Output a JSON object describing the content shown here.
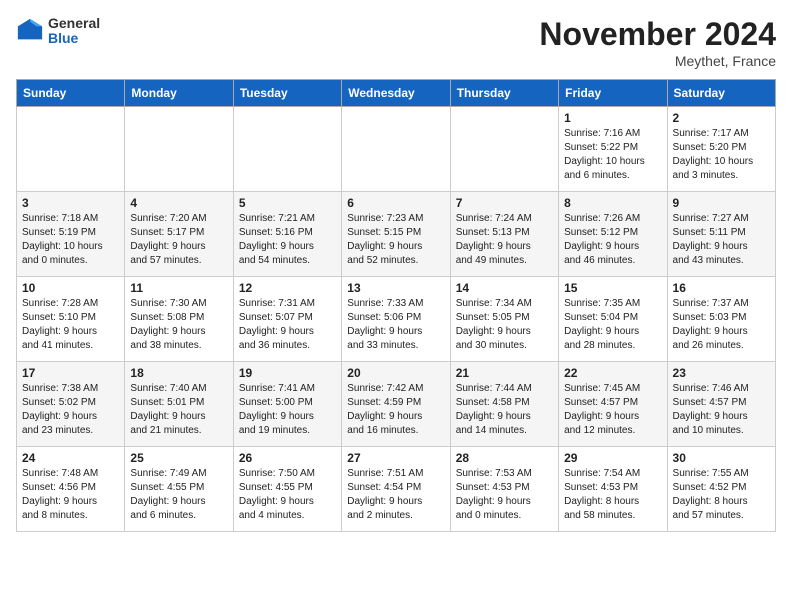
{
  "header": {
    "logo_general": "General",
    "logo_blue": "Blue",
    "month_title": "November 2024",
    "location": "Meythet, France"
  },
  "calendar": {
    "days_of_week": [
      "Sunday",
      "Monday",
      "Tuesday",
      "Wednesday",
      "Thursday",
      "Friday",
      "Saturday"
    ],
    "weeks": [
      [
        {
          "day": "",
          "info": ""
        },
        {
          "day": "",
          "info": ""
        },
        {
          "day": "",
          "info": ""
        },
        {
          "day": "",
          "info": ""
        },
        {
          "day": "",
          "info": ""
        },
        {
          "day": "1",
          "info": "Sunrise: 7:16 AM\nSunset: 5:22 PM\nDaylight: 10 hours\nand 6 minutes."
        },
        {
          "day": "2",
          "info": "Sunrise: 7:17 AM\nSunset: 5:20 PM\nDaylight: 10 hours\nand 3 minutes."
        }
      ],
      [
        {
          "day": "3",
          "info": "Sunrise: 7:18 AM\nSunset: 5:19 PM\nDaylight: 10 hours\nand 0 minutes."
        },
        {
          "day": "4",
          "info": "Sunrise: 7:20 AM\nSunset: 5:17 PM\nDaylight: 9 hours\nand 57 minutes."
        },
        {
          "day": "5",
          "info": "Sunrise: 7:21 AM\nSunset: 5:16 PM\nDaylight: 9 hours\nand 54 minutes."
        },
        {
          "day": "6",
          "info": "Sunrise: 7:23 AM\nSunset: 5:15 PM\nDaylight: 9 hours\nand 52 minutes."
        },
        {
          "day": "7",
          "info": "Sunrise: 7:24 AM\nSunset: 5:13 PM\nDaylight: 9 hours\nand 49 minutes."
        },
        {
          "day": "8",
          "info": "Sunrise: 7:26 AM\nSunset: 5:12 PM\nDaylight: 9 hours\nand 46 minutes."
        },
        {
          "day": "9",
          "info": "Sunrise: 7:27 AM\nSunset: 5:11 PM\nDaylight: 9 hours\nand 43 minutes."
        }
      ],
      [
        {
          "day": "10",
          "info": "Sunrise: 7:28 AM\nSunset: 5:10 PM\nDaylight: 9 hours\nand 41 minutes."
        },
        {
          "day": "11",
          "info": "Sunrise: 7:30 AM\nSunset: 5:08 PM\nDaylight: 9 hours\nand 38 minutes."
        },
        {
          "day": "12",
          "info": "Sunrise: 7:31 AM\nSunset: 5:07 PM\nDaylight: 9 hours\nand 36 minutes."
        },
        {
          "day": "13",
          "info": "Sunrise: 7:33 AM\nSunset: 5:06 PM\nDaylight: 9 hours\nand 33 minutes."
        },
        {
          "day": "14",
          "info": "Sunrise: 7:34 AM\nSunset: 5:05 PM\nDaylight: 9 hours\nand 30 minutes."
        },
        {
          "day": "15",
          "info": "Sunrise: 7:35 AM\nSunset: 5:04 PM\nDaylight: 9 hours\nand 28 minutes."
        },
        {
          "day": "16",
          "info": "Sunrise: 7:37 AM\nSunset: 5:03 PM\nDaylight: 9 hours\nand 26 minutes."
        }
      ],
      [
        {
          "day": "17",
          "info": "Sunrise: 7:38 AM\nSunset: 5:02 PM\nDaylight: 9 hours\nand 23 minutes."
        },
        {
          "day": "18",
          "info": "Sunrise: 7:40 AM\nSunset: 5:01 PM\nDaylight: 9 hours\nand 21 minutes."
        },
        {
          "day": "19",
          "info": "Sunrise: 7:41 AM\nSunset: 5:00 PM\nDaylight: 9 hours\nand 19 minutes."
        },
        {
          "day": "20",
          "info": "Sunrise: 7:42 AM\nSunset: 4:59 PM\nDaylight: 9 hours\nand 16 minutes."
        },
        {
          "day": "21",
          "info": "Sunrise: 7:44 AM\nSunset: 4:58 PM\nDaylight: 9 hours\nand 14 minutes."
        },
        {
          "day": "22",
          "info": "Sunrise: 7:45 AM\nSunset: 4:57 PM\nDaylight: 9 hours\nand 12 minutes."
        },
        {
          "day": "23",
          "info": "Sunrise: 7:46 AM\nSunset: 4:57 PM\nDaylight: 9 hours\nand 10 minutes."
        }
      ],
      [
        {
          "day": "24",
          "info": "Sunrise: 7:48 AM\nSunset: 4:56 PM\nDaylight: 9 hours\nand 8 minutes."
        },
        {
          "day": "25",
          "info": "Sunrise: 7:49 AM\nSunset: 4:55 PM\nDaylight: 9 hours\nand 6 minutes."
        },
        {
          "day": "26",
          "info": "Sunrise: 7:50 AM\nSunset: 4:55 PM\nDaylight: 9 hours\nand 4 minutes."
        },
        {
          "day": "27",
          "info": "Sunrise: 7:51 AM\nSunset: 4:54 PM\nDaylight: 9 hours\nand 2 minutes."
        },
        {
          "day": "28",
          "info": "Sunrise: 7:53 AM\nSunset: 4:53 PM\nDaylight: 9 hours\nand 0 minutes."
        },
        {
          "day": "29",
          "info": "Sunrise: 7:54 AM\nSunset: 4:53 PM\nDaylight: 8 hours\nand 58 minutes."
        },
        {
          "day": "30",
          "info": "Sunrise: 7:55 AM\nSunset: 4:52 PM\nDaylight: 8 hours\nand 57 minutes."
        }
      ]
    ]
  }
}
